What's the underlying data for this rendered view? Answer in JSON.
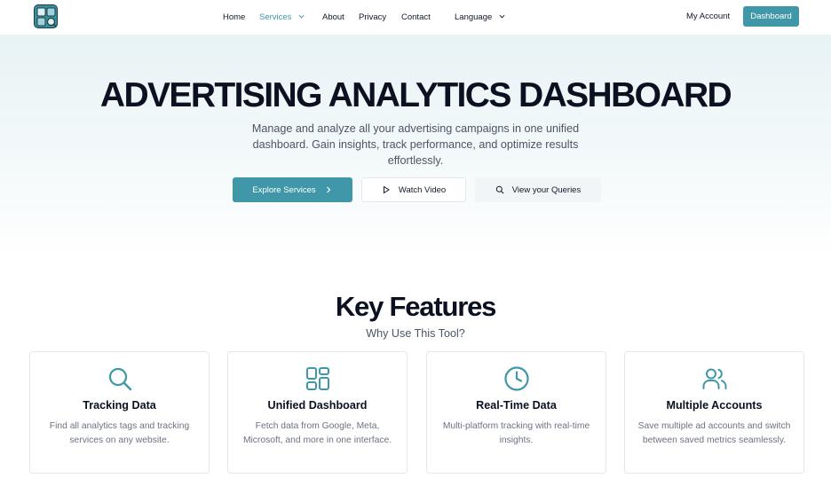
{
  "nav": {
    "items": [
      "Home",
      "Services",
      "About",
      "Privacy",
      "Contact"
    ],
    "language": "Language",
    "my_account": "My Account",
    "dashboard": "Dashboard"
  },
  "hero": {
    "title": "ADVERTISING ANALYTICS DASHBOARD",
    "subtitle": "Manage and analyze all your advertising campaigns in one unified dashboard. Gain insights, track performance, and optimize results effortlessly.",
    "buttons": {
      "explore": "Explore Services",
      "video": "Watch Video",
      "queries": "View your Queries"
    }
  },
  "features": {
    "title": "Key Features",
    "subtitle": "Why Use This Tool?",
    "cards": [
      {
        "icon": "search-icon",
        "title": "Tracking Data",
        "desc": "Find all analytics tags and tracking services on any website."
      },
      {
        "icon": "dashboard-grid-icon",
        "title": "Unified Dashboard",
        "desc": "Fetch data from Google, Meta, Microsoft, and more in one interface."
      },
      {
        "icon": "clock-icon",
        "title": "Real-Time Data",
        "desc": "Multi-platform tracking with real-time insights."
      },
      {
        "icon": "users-icon",
        "title": "Multiple Accounts",
        "desc": "Save multiple ad accounts and switch between saved metrics seamlessly."
      }
    ]
  },
  "colors": {
    "accent": "#3f97a8",
    "heading": "#0b1120",
    "muted": "#6b7280"
  }
}
